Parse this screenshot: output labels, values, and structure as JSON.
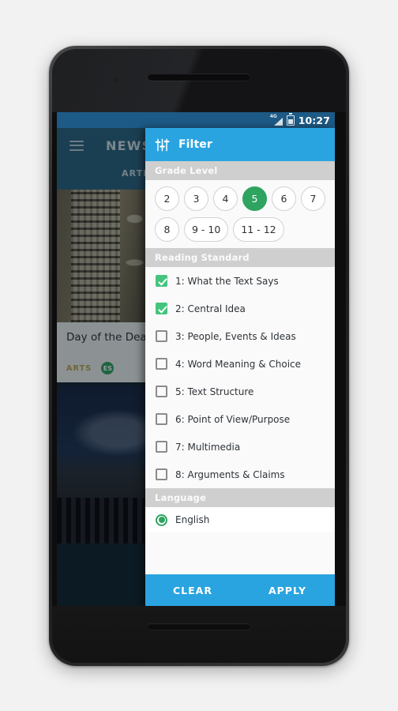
{
  "status_bar": {
    "network": "4G",
    "network_icon": "signal-4g-icon",
    "battery_icon": "battery-icon",
    "time": "10:27"
  },
  "background_app": {
    "menu_icon": "hamburger-menu-icon",
    "app_title": "NEWSELA",
    "tab_label": "ARTICLES",
    "articles": [
      {
        "headline": "Day of the Dead: remembering loved ones",
        "category": "ARTS",
        "language_badge": "ES",
        "image_name": "day-of-the-dead-papel-picado-skulls"
      },
      {
        "image_name": "crowd-outside-classical-building"
      }
    ]
  },
  "filter_panel": {
    "icon": "tune-sliders-icon",
    "title": "Filter",
    "sections": {
      "grade_level": {
        "header": "Grade Level",
        "options": [
          "2",
          "3",
          "4",
          "5",
          "6",
          "7",
          "8",
          "9 - 10",
          "11 - 12"
        ],
        "selected": "5"
      },
      "reading_standard": {
        "header": "Reading Standard",
        "items": [
          {
            "label": "1: What the Text Says",
            "checked": true
          },
          {
            "label": "2: Central Idea",
            "checked": true
          },
          {
            "label": "3: People, Events & Ideas",
            "checked": false
          },
          {
            "label": "4: Word Meaning & Choice",
            "checked": false
          },
          {
            "label": "5: Text Structure",
            "checked": false
          },
          {
            "label": "6: Point of View/Purpose",
            "checked": false
          },
          {
            "label": "7: Multimedia",
            "checked": false
          },
          {
            "label": "8: Arguments & Claims",
            "checked": false
          }
        ]
      },
      "language": {
        "header": "Language",
        "options": [
          {
            "label": "English",
            "selected": true
          }
        ]
      }
    },
    "footer": {
      "clear_label": "CLEAR",
      "apply_label": "APPLY"
    }
  },
  "nav_bar": {
    "back_icon": "back-triangle-icon",
    "home_icon": "home-circle-icon",
    "recents_icon": "recents-square-icon"
  },
  "colors": {
    "accent_blue": "#29a4e0",
    "status_bar_blue": "#1d5a86",
    "selection_green": "#2fa360",
    "checkbox_green": "#44c47d",
    "section_header_gray": "#cfcfcf"
  }
}
